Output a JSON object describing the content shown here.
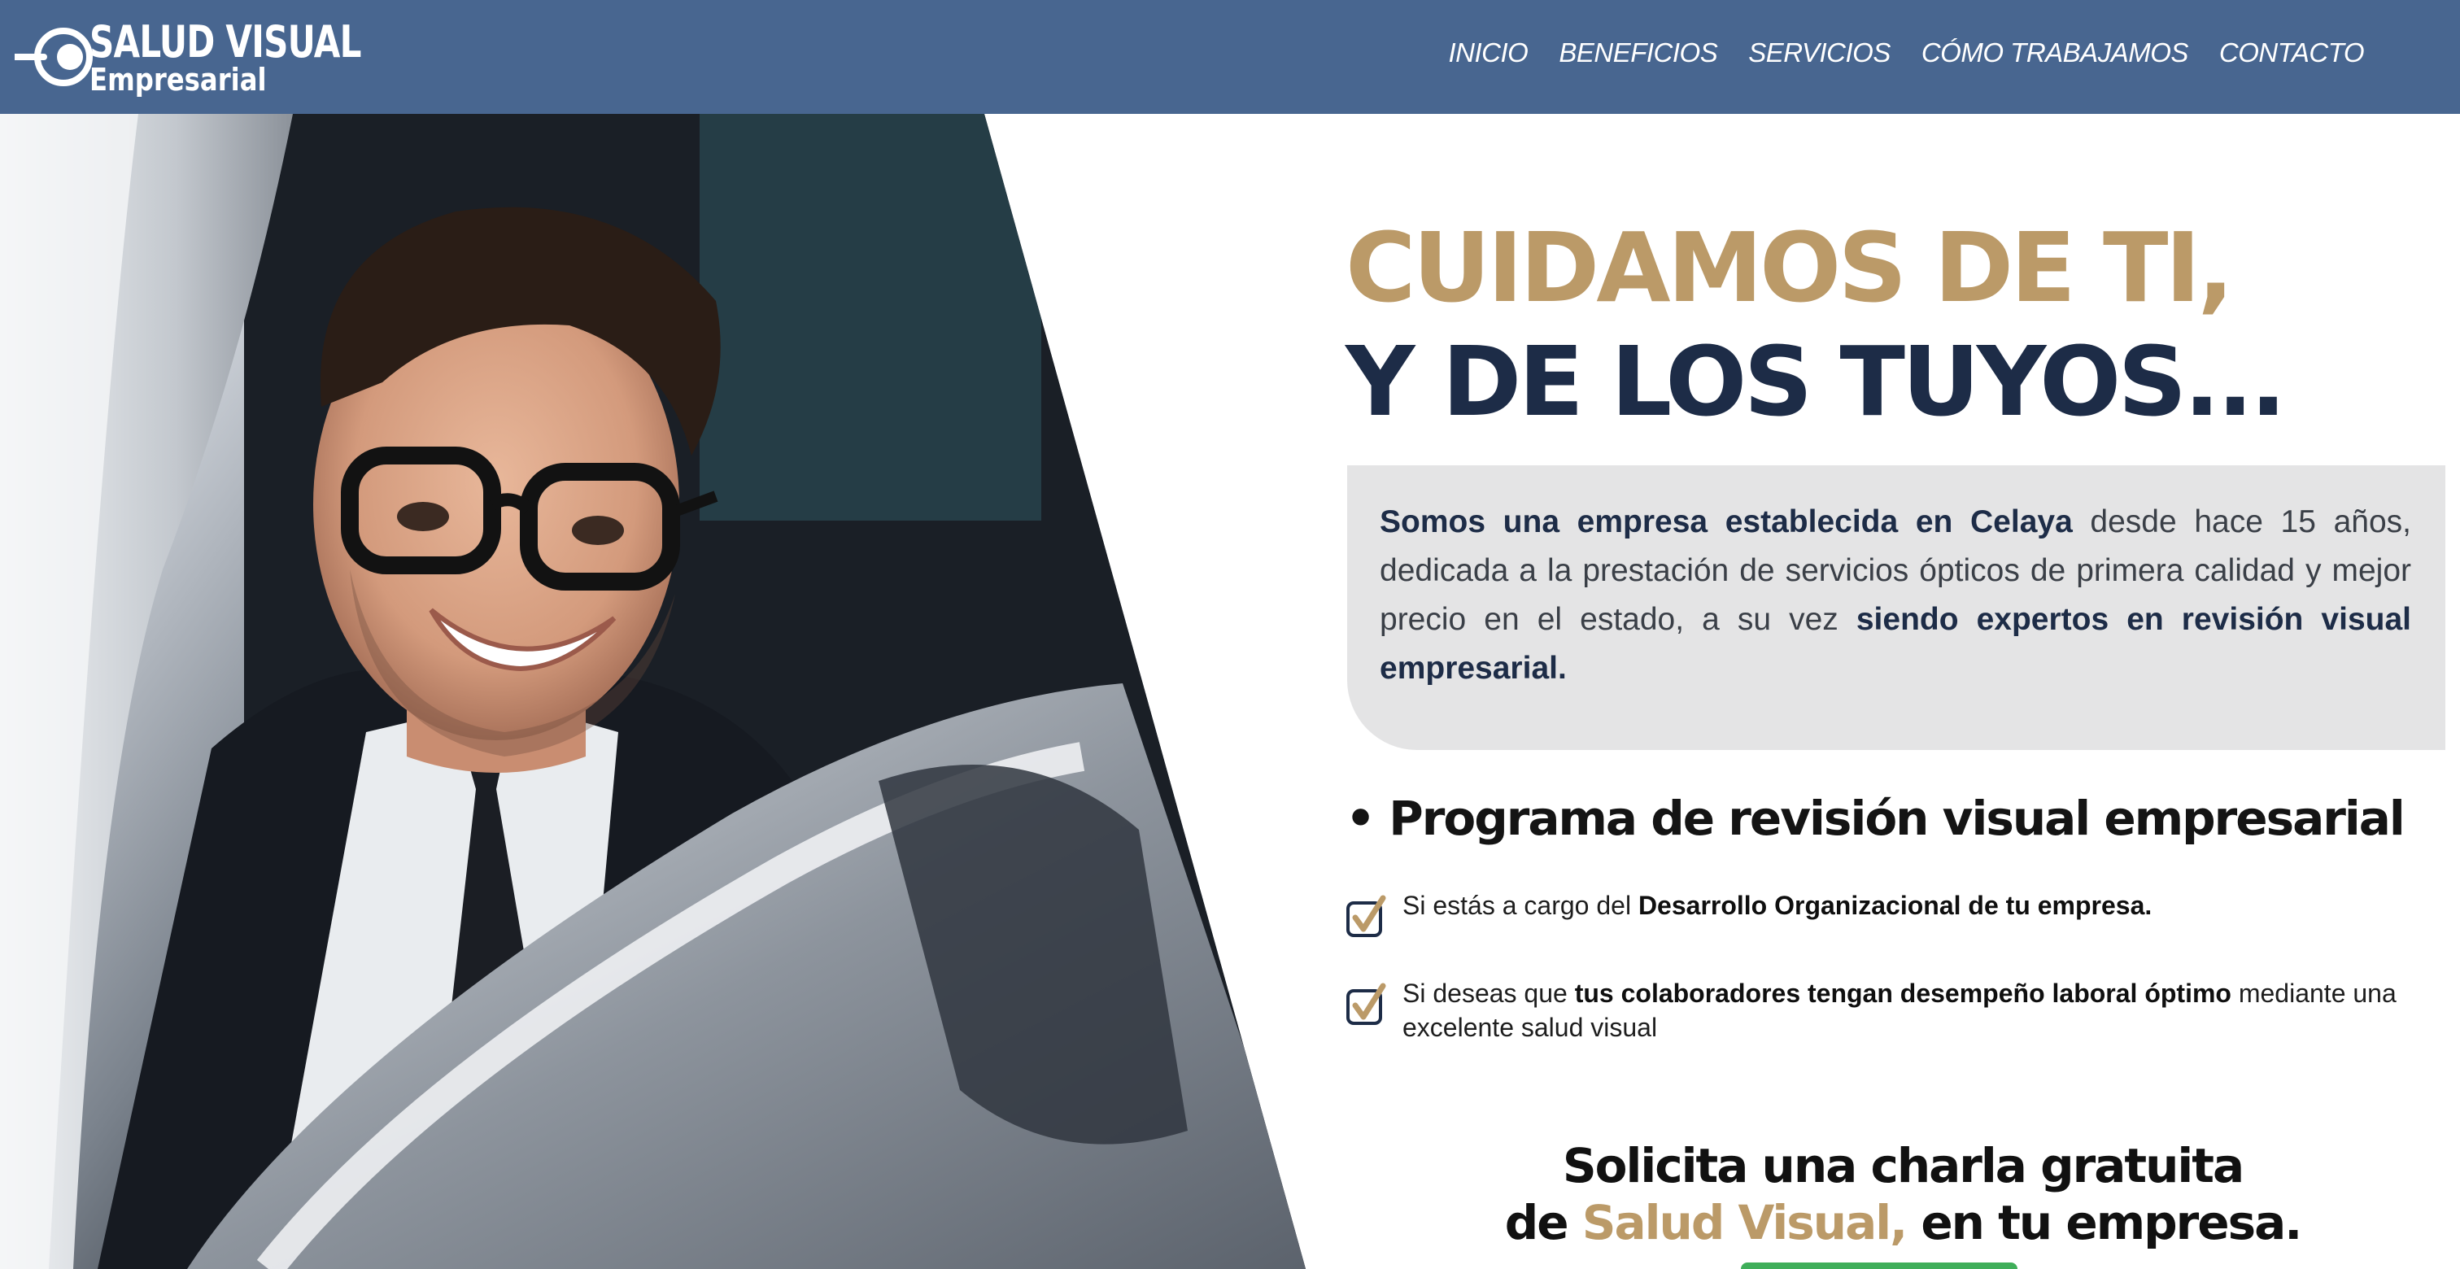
{
  "brand": {
    "line1": "SALUD VISUAL",
    "line2": "Empresarial",
    "colors": {
      "navy": "#486690",
      "gold": "#bb9a68",
      "dark": "#1d2c47"
    }
  },
  "nav": {
    "items": [
      {
        "label": "INICIO"
      },
      {
        "label": "BENEFICIOS"
      },
      {
        "label": "SERVICIOS"
      },
      {
        "label": "CÓMO TRABAJAMOS"
      },
      {
        "label": "CONTACTO"
      }
    ]
  },
  "hero": {
    "headline_line1": "CUIDAMOS DE TI,",
    "headline_line2": "Y DE LOS TUYOS...",
    "intro_bold1": "Somos una empresa establecida en Celaya",
    "intro_text": " desde hace 15 años, dedicada a la prestación de servicios ópticos de primera calidad y mejor precio en el estado, a su vez ",
    "intro_bold2": "siendo expertos en revisión visual empresarial."
  },
  "program": {
    "title": "• Programa de revisión visual empresarial",
    "items": [
      {
        "pre": "Si estás a cargo del ",
        "bold": "Desarrollo Organizacional de tu empresa.",
        "post": ""
      },
      {
        "pre": "Si deseas que ",
        "bold": "tus colaboradores tengan desempeño laboral óptimo",
        "post": " mediante una excelente salud visual"
      }
    ]
  },
  "cta": {
    "line1": "Solicita una charla gratuita",
    "line2_pre": "de ",
    "line2_accent": "Salud Visual,",
    "line2_post": " en tu empresa."
  }
}
